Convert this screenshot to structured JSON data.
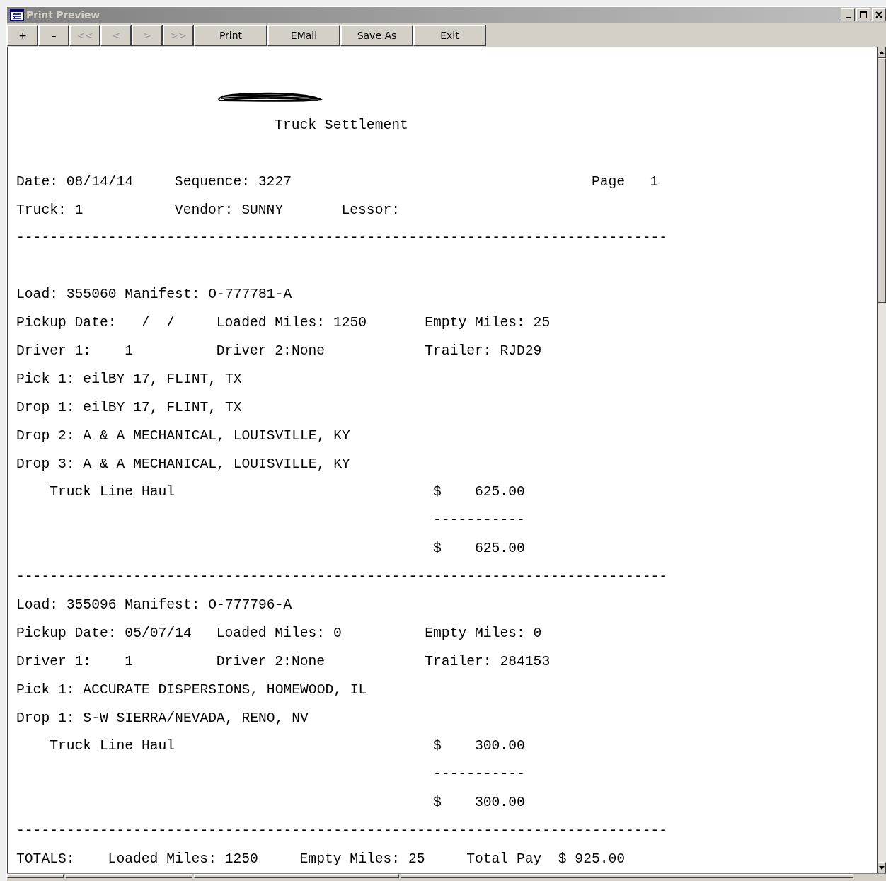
{
  "window": {
    "title": "Print Preview"
  },
  "toolbar": [
    {
      "label": "+",
      "disabled": false
    },
    {
      "label": "–",
      "disabled": false
    },
    {
      "label": "<<",
      "disabled": true
    },
    {
      "label": "<",
      "disabled": true
    },
    {
      "label": ">",
      "disabled": true
    },
    {
      "label": ">>",
      "disabled": true
    },
    {
      "label": "Print",
      "disabled": false
    },
    {
      "label": "EMail",
      "disabled": false
    },
    {
      "label": "Save As",
      "disabled": false
    },
    {
      "label": "Exit",
      "disabled": false
    }
  ],
  "report": {
    "title": "Truck Settlement",
    "header": {
      "date": "Date: 08/14/14",
      "sequence": "Sequence: 3227",
      "page": "Page   1",
      "truck": "Truck: 1",
      "vendor": "Vendor: SUNNY",
      "lessor": "Lessor:",
      "rule": "------------------------------------------------------------------------------"
    },
    "loads": [
      {
        "load": "Load: 355060 Manifest: O-777781-A",
        "pickup": "Pickup Date:   /  /",
        "loaded_miles": "Loaded Miles: 1250",
        "empty_miles": "Empty Miles: 25",
        "driver1": "Driver 1:    1",
        "driver2": "Driver 2:None",
        "trailer": "Trailer: RJD29",
        "stops": [
          "Pick 1: eilBY 17, FLINT, TX",
          "Drop 1: eilBY 17, FLINT, TX",
          "Drop 2: A & A MECHANICAL, LOUISVILLE, KY",
          "Drop 3: A & A MECHANICAL, LOUISVILLE, KY"
        ],
        "charges": [
          {
            "description": "Truck Line Haul",
            "currency": "$",
            "amount": "625.00"
          }
        ],
        "subtotal_rule": "-----------",
        "subtotal": {
          "currency": "$",
          "amount": "625.00"
        },
        "rule": "------------------------------------------------------------------------------"
      },
      {
        "load": "Load: 355096 Manifest: O-777796-A",
        "pickup": "Pickup Date: 05/07/14",
        "loaded_miles": "Loaded Miles: 0",
        "empty_miles": "Empty Miles: 0",
        "driver1": "Driver 1:    1",
        "driver2": "Driver 2:None",
        "trailer": "Trailer: 284153",
        "stops": [
          "Pick 1: ACCURATE DISPERSIONS, HOMEWOOD, IL",
          "Drop 1: S-W SIERRA/NEVADA, RENO, NV"
        ],
        "charges": [
          {
            "description": "Truck Line Haul",
            "currency": "$",
            "amount": "300.00"
          }
        ],
        "subtotal_rule": "-----------",
        "subtotal": {
          "currency": "$",
          "amount": "300.00"
        },
        "rule": "------------------------------------------------------------------------------"
      }
    ],
    "totals": {
      "label": "TOTALS:",
      "loaded_miles": "Loaded Miles: 1250",
      "empty_miles": "Empty Miles: 25",
      "total_pay_label": "Total Pay",
      "currency": "$",
      "amount": "925.00"
    }
  }
}
